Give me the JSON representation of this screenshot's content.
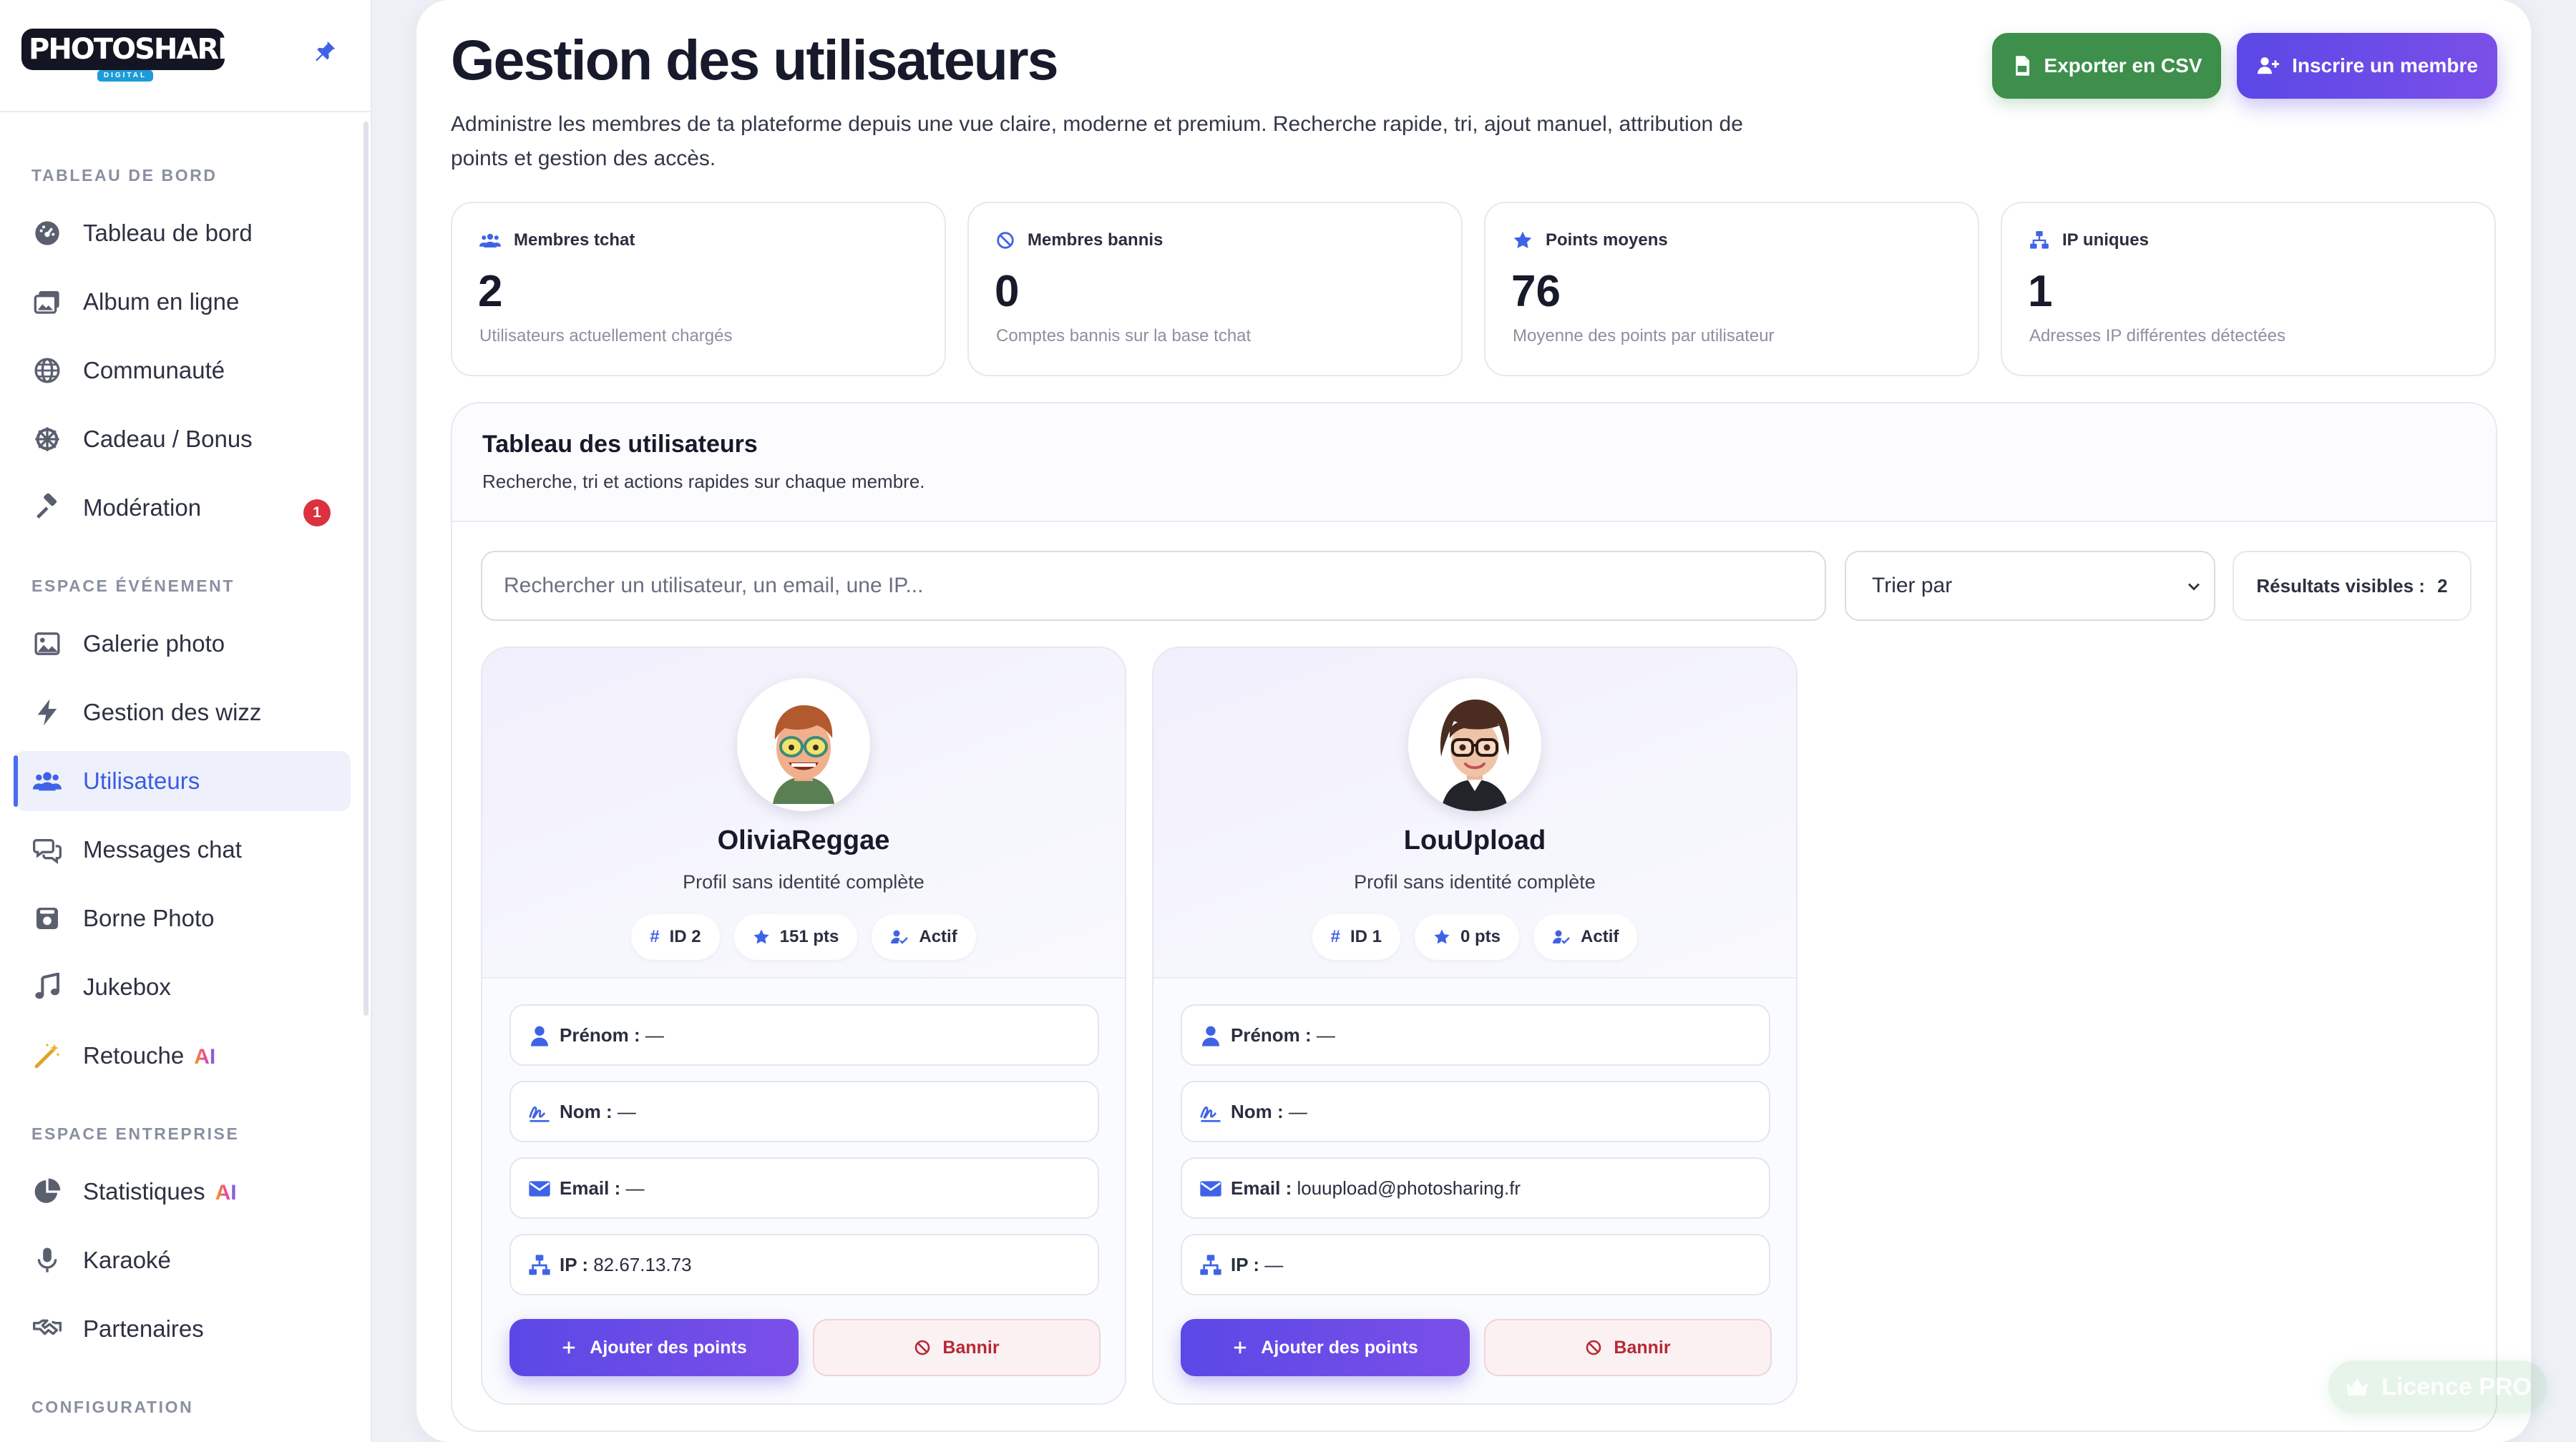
{
  "logo": {
    "text": "PHOTOSHARING",
    "sub": "DIGITAL"
  },
  "sidebar": {
    "sections": {
      "dashboard": "TABLEAU DE BORD",
      "event": "ESPACE ÉVÉNEMENT",
      "business": "ESPACE ENTREPRISE",
      "config": "CONFIGURATION"
    },
    "items": [
      {
        "label": "Tableau de bord",
        "icon": "dashboard-icon"
      },
      {
        "label": "Album en ligne",
        "icon": "images-icon"
      },
      {
        "label": "Communauté",
        "icon": "globe-icon"
      },
      {
        "label": "Cadeau / Bonus",
        "icon": "dharma-wheel-icon"
      },
      {
        "label": "Modération",
        "icon": "gavel-icon",
        "badge": "1"
      },
      {
        "label": "Galerie photo",
        "icon": "image-icon"
      },
      {
        "label": "Gestion des wizz",
        "icon": "bolt-icon"
      },
      {
        "label": "Utilisateurs",
        "icon": "users-icon",
        "active": true
      },
      {
        "label": "Messages chat",
        "icon": "chat-icon"
      },
      {
        "label": "Borne Photo",
        "icon": "camera-booth-icon"
      },
      {
        "label": "Jukebox",
        "icon": "music-icon"
      },
      {
        "label": "Retouche",
        "icon": "magic-wand-icon",
        "ai": "AI"
      },
      {
        "label": "Statistiques",
        "icon": "pie-chart-icon",
        "ai": "AI"
      },
      {
        "label": "Karaoké",
        "icon": "microphone-icon"
      },
      {
        "label": "Partenaires",
        "icon": "handshake-icon"
      }
    ]
  },
  "header": {
    "title": "Gestion des utilisateurs",
    "description": "Administre les membres de ta plateforme depuis une vue claire, moderne et premium. Recherche rapide, tri, ajout manuel, attribution de points et gestion des accès.",
    "export_label": "Exporter en CSV",
    "join_label": "Inscrire un membre"
  },
  "stats": [
    {
      "label": "Membres tchat",
      "value": "2",
      "desc": "Utilisateurs actuellement chargés",
      "icon": "users-icon"
    },
    {
      "label": "Membres bannis",
      "value": "0",
      "desc": "Comptes bannis sur la base tchat",
      "icon": "ban-icon"
    },
    {
      "label": "Points moyens",
      "value": "76",
      "desc": "Moyenne des points par utilisateur",
      "icon": "star-icon"
    },
    {
      "label": "IP uniques",
      "value": "1",
      "desc": "Adresses IP différentes détectées",
      "icon": "network-icon"
    }
  ],
  "table": {
    "title": "Tableau des utilisateurs",
    "subtitle": "Recherche, tri et actions rapides sur chaque membre.",
    "search_placeholder": "Rechercher un utilisateur, un email, une IP...",
    "sort_label": "Trier par",
    "results_label": "Résultats visibles :",
    "results_count": "2"
  },
  "users": [
    {
      "username": "OliviaReggae",
      "profile": "Profil sans identité complète",
      "id": "ID 2",
      "points": "151 pts",
      "status": "Actif",
      "firstname_label": "Prénom :",
      "firstname": "—",
      "lastname_label": "Nom :",
      "lastname": "—",
      "email_label": "Email :",
      "email": "—",
      "ip_label": "IP :",
      "ip": "82.67.13.73",
      "add_label": "Ajouter des points",
      "ban_label": "Bannir"
    },
    {
      "username": "LouUpload",
      "profile": "Profil sans identité complète",
      "id": "ID 1",
      "points": "0 pts",
      "status": "Actif",
      "firstname_label": "Prénom :",
      "firstname": "—",
      "lastname_label": "Nom :",
      "lastname": "—",
      "email_label": "Email :",
      "email": "louupload@photosharing.fr",
      "ip_label": "IP :",
      "ip": "—",
      "add_label": "Ajouter des points",
      "ban_label": "Bannir"
    }
  ],
  "licence": {
    "label": "Licence PRO"
  },
  "colors": {
    "accent": "#4a6cf0",
    "primary_gradient": "#5a48e6",
    "success": "#3d8f4b",
    "danger": "#dc3240"
  }
}
